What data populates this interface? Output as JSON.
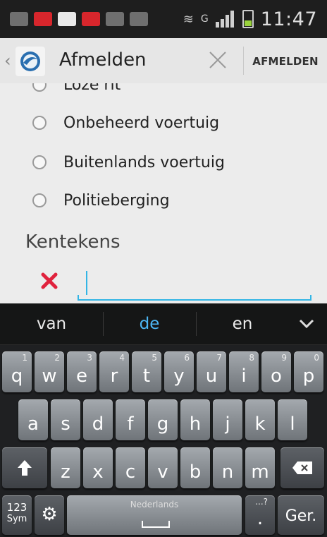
{
  "status_bar": {
    "time": "11:47",
    "network_letter": "G"
  },
  "action_bar": {
    "title": "Afmelden",
    "action_label": "AFMELDEN"
  },
  "options": [
    {
      "label": "Loze rit",
      "selected": false
    },
    {
      "label": "Onbeheerd voertuig",
      "selected": false
    },
    {
      "label": "Buitenlands voertuig",
      "selected": false
    },
    {
      "label": "Politieberging",
      "selected": false
    }
  ],
  "license_plate": {
    "label": "Kentekens",
    "value": ""
  },
  "keyboard": {
    "suggestions": [
      "van",
      "de",
      "en"
    ],
    "row1": [
      {
        "char": "q",
        "num": "1"
      },
      {
        "char": "w",
        "num": "2"
      },
      {
        "char": "e",
        "num": "3"
      },
      {
        "char": "r",
        "num": "4"
      },
      {
        "char": "t",
        "num": "5"
      },
      {
        "char": "y",
        "num": "6"
      },
      {
        "char": "u",
        "num": "7"
      },
      {
        "char": "i",
        "num": "8"
      },
      {
        "char": "o",
        "num": "9"
      },
      {
        "char": "p",
        "num": "0"
      }
    ],
    "row2": [
      "a",
      "s",
      "d",
      "f",
      "g",
      "h",
      "j",
      "k",
      "l"
    ],
    "row3": [
      "z",
      "x",
      "c",
      "v",
      "b",
      "n",
      "m"
    ],
    "sym_label_top": "123",
    "sym_label_bottom": "Sym",
    "space_language": "Nederlands",
    "period": ".",
    "period_alt": "...?",
    "enter_label": "Ger."
  },
  "colors": {
    "accent": "#33b5e5",
    "suggestion_highlight": "#4db6f4",
    "clear_icon": "#e0223d"
  }
}
